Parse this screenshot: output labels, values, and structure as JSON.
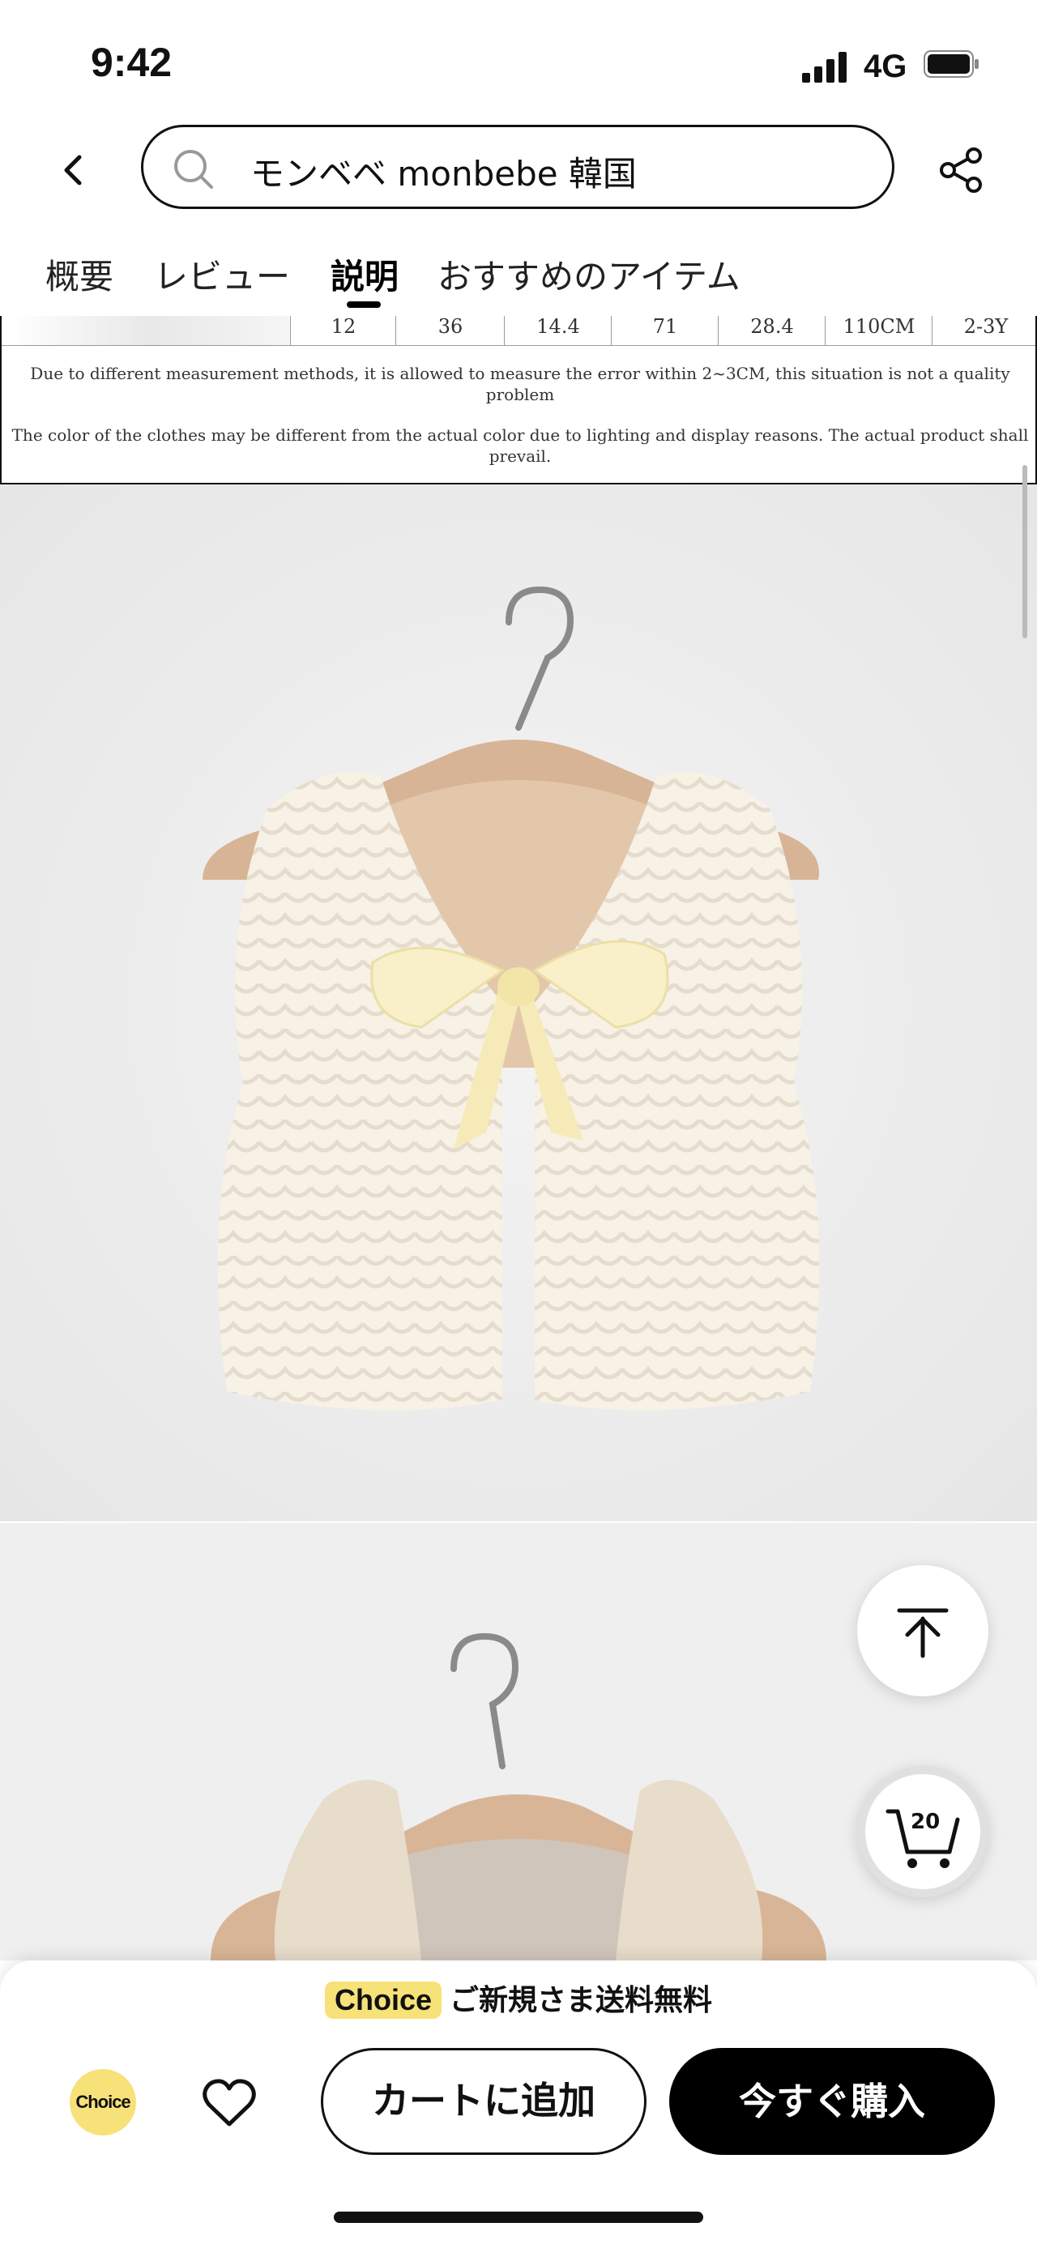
{
  "status_bar": {
    "time": "9:42",
    "network": "4G"
  },
  "search": {
    "query": "モンベベ monbebe 韓国"
  },
  "tabs": [
    {
      "label": "概要"
    },
    {
      "label": "レビュー"
    },
    {
      "label": "説明"
    },
    {
      "label": "おすすめのアイテム"
    }
  ],
  "active_tab": "説明",
  "size_table": {
    "row": [
      "12",
      "36",
      "14.4",
      "71",
      "28.4",
      "110CM",
      "2-3Y"
    ],
    "note1": "Due to different measurement methods, it is allowed to measure the error within 2~3CM, this situation is not a quality problem",
    "note2": "The color of the clothes may be different from the actual color due to lighting and display reasons. The actual product shall prevail."
  },
  "cart_count": "20",
  "promo": {
    "badge": "Choice",
    "text": "ご新規さま送料無料"
  },
  "bottom_bar": {
    "choice_label": "Choice",
    "add_to_cart": "カートに追加",
    "buy_now": "今すぐ購入"
  },
  "icons": [
    "signal-icon",
    "battery-icon",
    "back-arrow-icon",
    "search-icon",
    "share-icon",
    "scroll-to-top-icon",
    "cart-icon",
    "heart-icon"
  ],
  "colors": {
    "choice_yellow": "#f7e27a",
    "buy_button": "#000000",
    "product_bg": "#ececec"
  }
}
